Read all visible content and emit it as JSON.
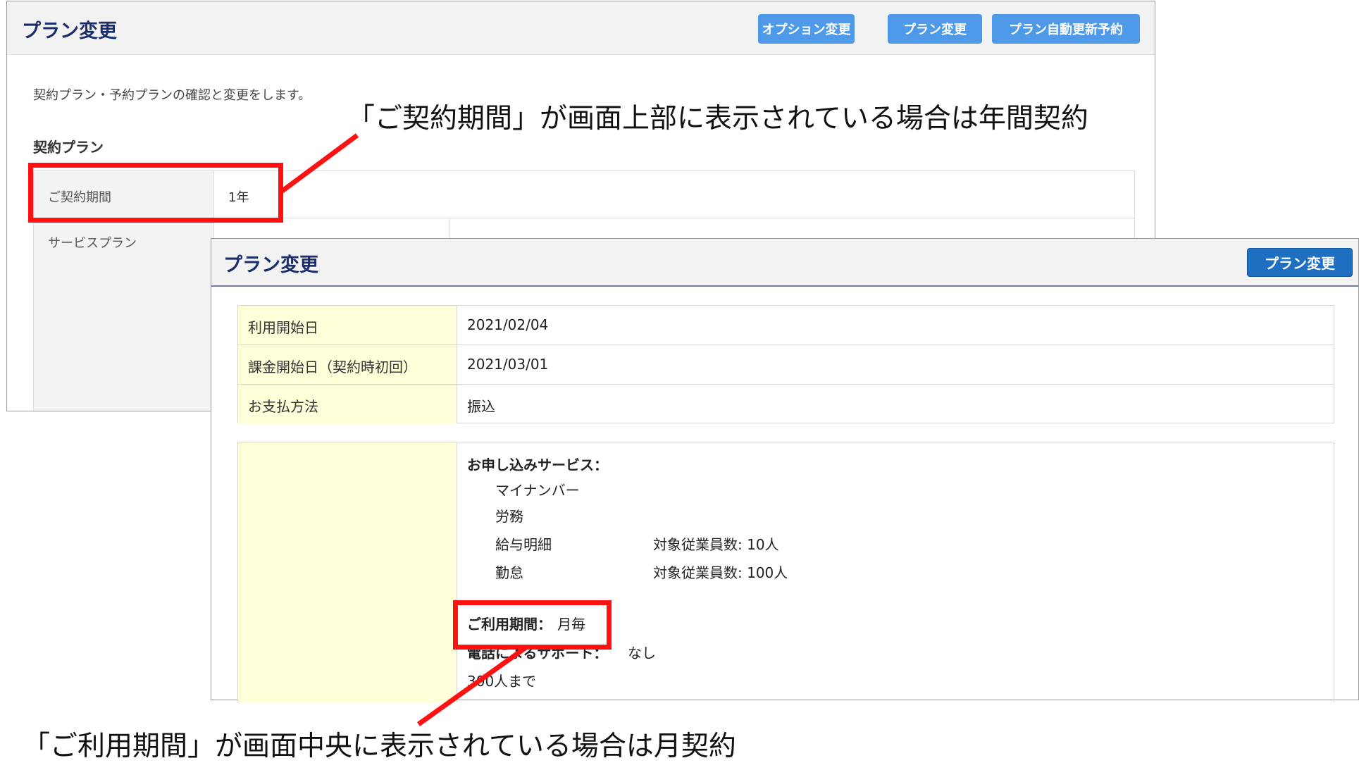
{
  "panel_annual": {
    "title": "プラン変更",
    "buttons": {
      "option_change": "オプション変更",
      "plan_change": "プラン変更",
      "auto_renew": "プラン自動更新予約"
    },
    "description": "契約プラン・予約プランの確認と変更をします。",
    "section_title": "契約プラン",
    "rows": [
      {
        "label": "ご契約期間",
        "value": "1年"
      },
      {
        "label": "サービスプラン",
        "value": ""
      }
    ]
  },
  "panel_monthly": {
    "title": "プラン変更",
    "buttons": {
      "plan_change": "プラン変更"
    },
    "rows": [
      {
        "label": "利用開始日",
        "value": "2021/02/04"
      },
      {
        "label": "課金開始日（契約時初回）",
        "value": "2021/03/01"
      },
      {
        "label": "お支払方法",
        "value": "振込"
      }
    ],
    "services": {
      "heading": "お申し込みサービス：",
      "items": [
        {
          "name": "マイナンバー",
          "detail": ""
        },
        {
          "name": "労務",
          "detail": ""
        },
        {
          "name": "給与明細",
          "detail": "対象従業員数: 10人"
        },
        {
          "name": "勤怠",
          "detail": "対象従業員数: 100人"
        }
      ],
      "period_label": "ご利用期間：",
      "period_value": "月毎",
      "support_label": "電話によるサポート：",
      "support_value": "なし",
      "capacity": "300人まで"
    }
  },
  "annotations": {
    "annual": "「ご契約期間」が画面上部に表示されている場合は年間契約",
    "monthly": "「ご利用期間」が画面中央に表示されている場合は月契約"
  },
  "colors": {
    "callout": "#ff1111",
    "title": "#1a2c6b",
    "button_light": "#4f9ae8",
    "button_dark": "#1f6fc0",
    "label_bg_yellow": "#fefed9",
    "label_bg_gray": "#f3f3f3"
  }
}
